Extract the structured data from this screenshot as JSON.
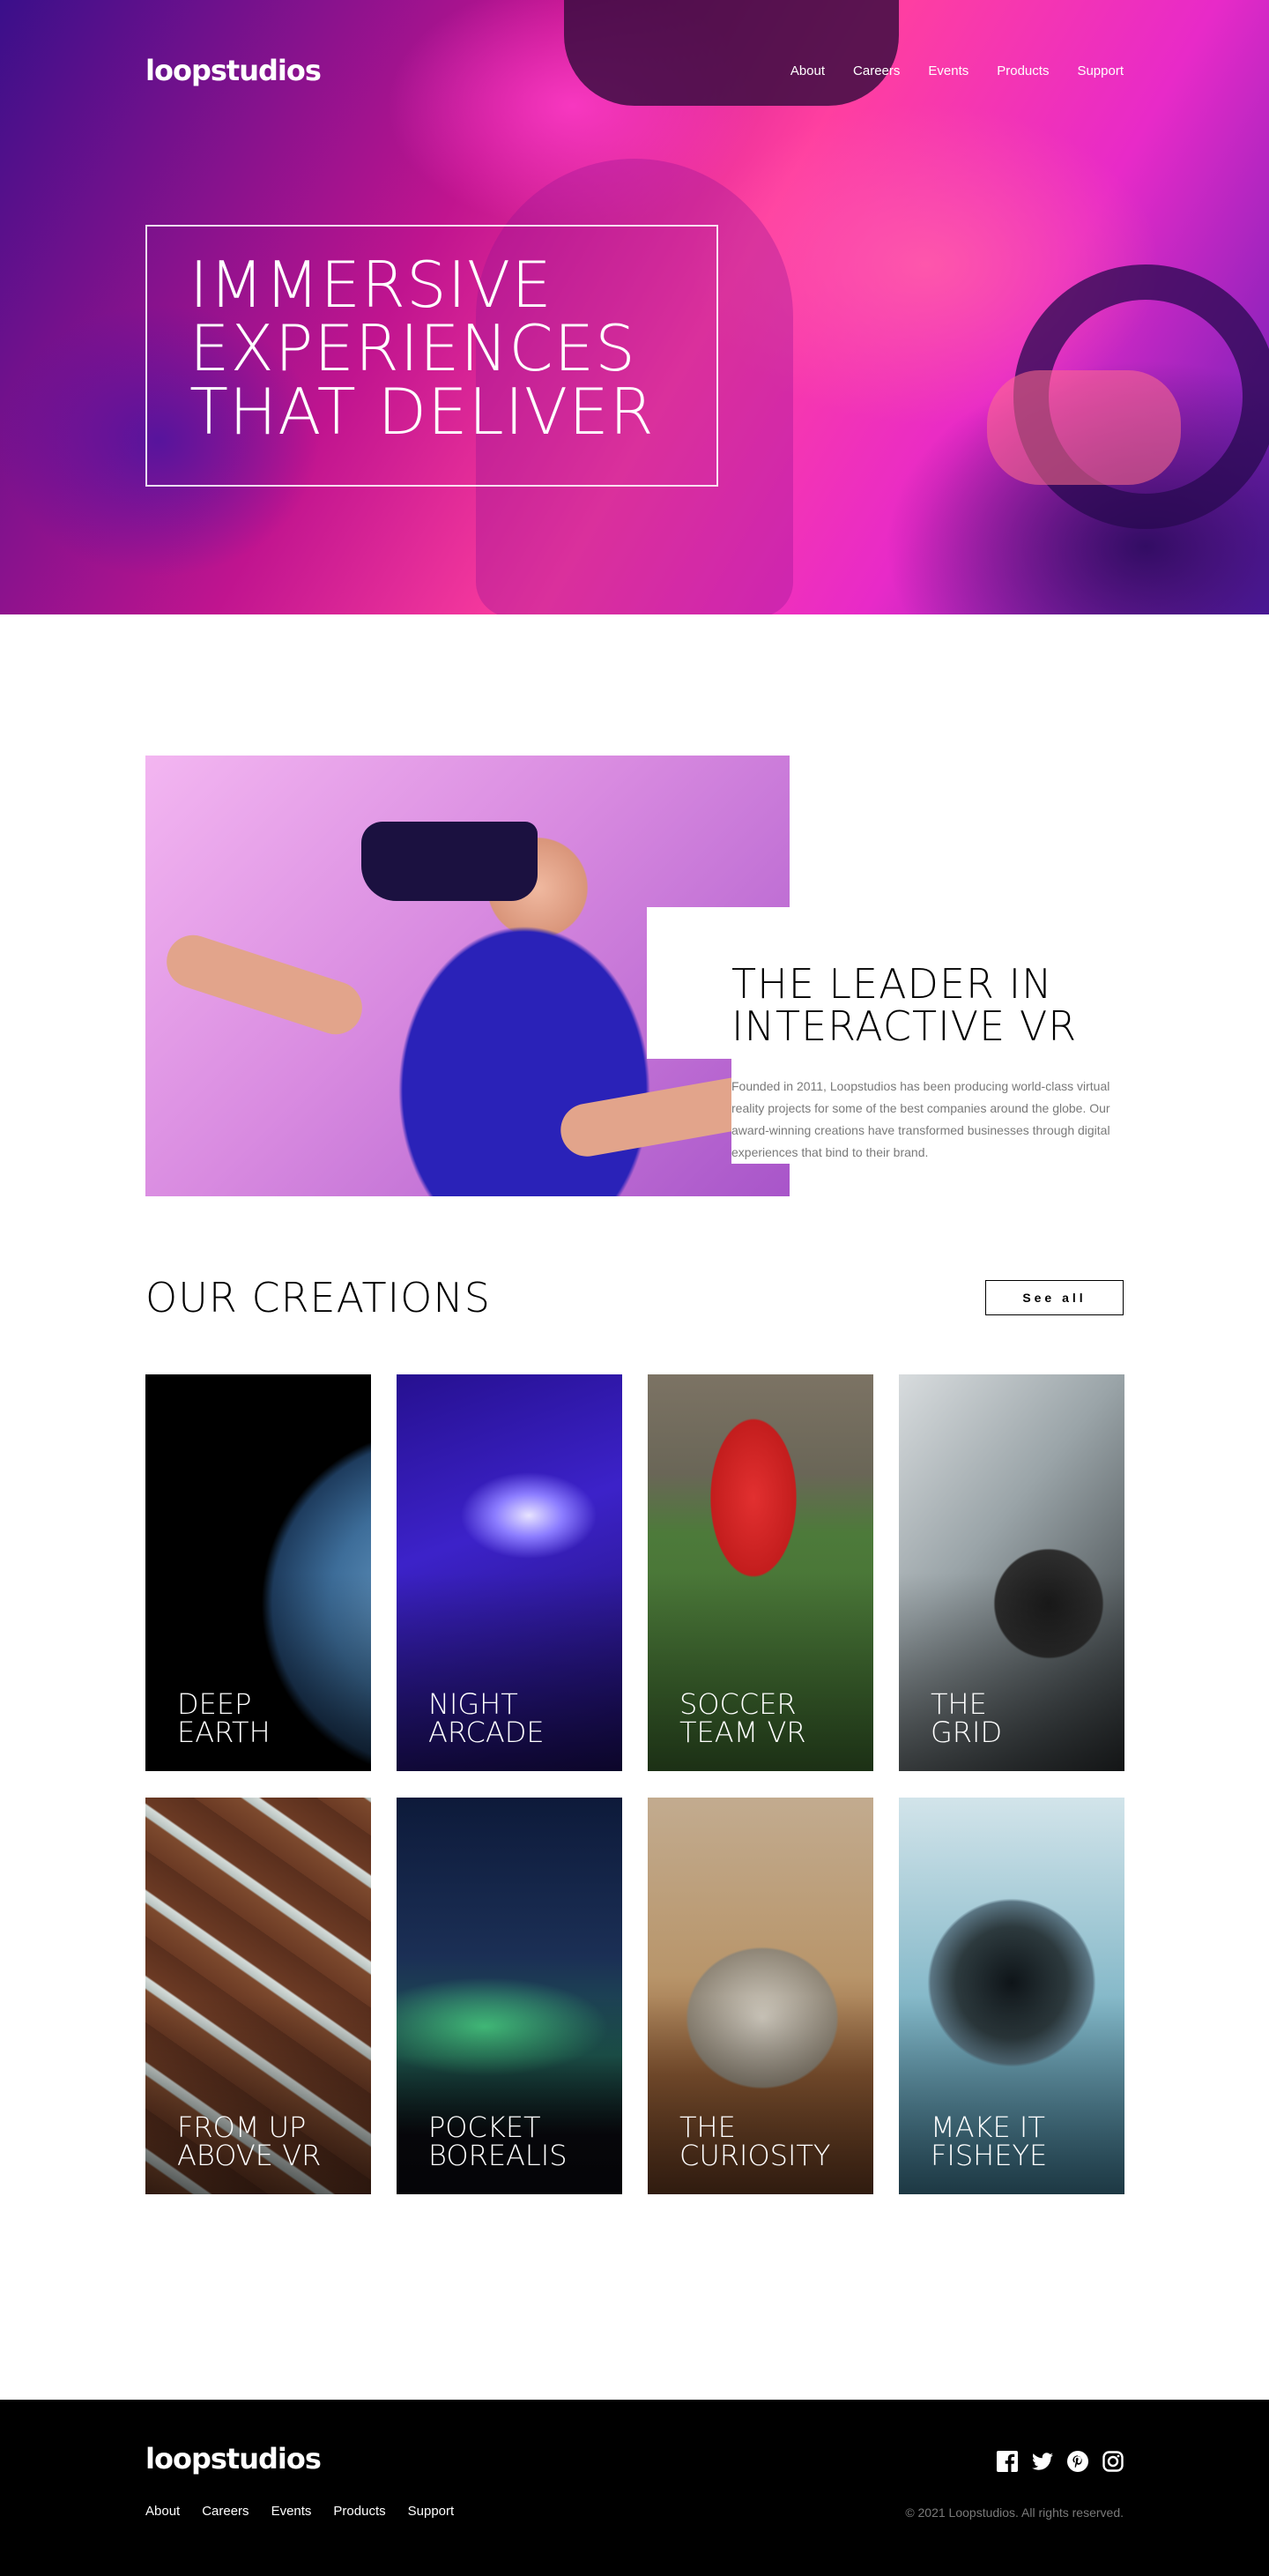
{
  "brand": {
    "logo": "loopstudios"
  },
  "nav": {
    "items": [
      "About",
      "Careers",
      "Events",
      "Products",
      "Support"
    ]
  },
  "hero": {
    "title": "Immersive experiences that deliver"
  },
  "interactive": {
    "title": "The leader in interactive VR",
    "text": "Founded in 2011, Loopstudios has been producing world-class virtual reality projects for some of the best companies around the globe. Our award-winning creations have transformed businesses through digital experiences that bind to their brand."
  },
  "creations": {
    "title": "Our creations",
    "see_all": "See all",
    "items": [
      {
        "title": "Deep\nEarth"
      },
      {
        "title": "Night\nArcade"
      },
      {
        "title": "Soccer\nTeam VR"
      },
      {
        "title": "The\nGrid"
      },
      {
        "title": "From up\nabove VR"
      },
      {
        "title": "Pocket\nBorealis"
      },
      {
        "title": "The\nCuriosity"
      },
      {
        "title": "Make it\nfisheye"
      }
    ]
  },
  "footer": {
    "logo": "loopstudios",
    "links": [
      "About",
      "Careers",
      "Events",
      "Products",
      "Support"
    ],
    "socials": [
      "facebook-icon",
      "twitter-icon",
      "pinterest-icon",
      "instagram-icon"
    ],
    "copyright": "© 2021 Loopstudios. All rights reserved."
  }
}
